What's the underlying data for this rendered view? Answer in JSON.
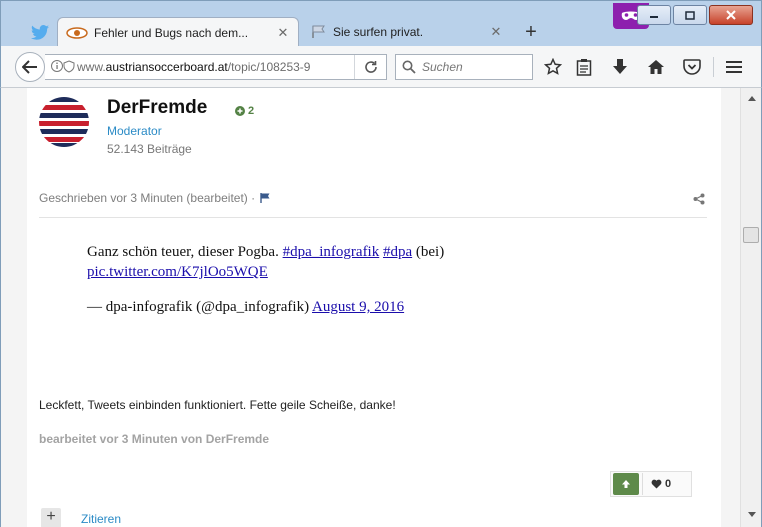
{
  "browser": {
    "tabs": [
      {
        "label": "Fehler und Bugs nach dem..."
      },
      {
        "label": "Sie surfen privat."
      }
    ],
    "url_prefix": "www.",
    "url_domain": "austriansoccerboard.at",
    "url_path": "/topic/108253-9",
    "search_placeholder": "Suchen"
  },
  "post": {
    "author": "DerFremde",
    "reputation": "2",
    "role": "Moderator",
    "post_count": "52.143 Beiträge",
    "meta": "Geschrieben vor 3 Minuten (bearbeitet) ·",
    "tweet": {
      "text": "Ganz schön teuer, dieser Pogba.",
      "hashtag1": "#dpa_infografik",
      "hashtag2": "#dpa",
      "suffix": "(bei)",
      "pic_link": "pic.twitter.com/K7jlOo5WQE",
      "signature": "— dpa-infografik (@dpa_infografik)",
      "date": "August 9, 2016"
    },
    "comment": "Leckfett, Tweets einbinden funktioniert. Fette geile Scheiße, danke!",
    "edited": "bearbeitet vor 3 Minuten von DerFremde",
    "likes": "0",
    "cutoff_action": "Zitieren"
  },
  "colors": {
    "moderator": "#2b8bc6",
    "upvote": "#5e8a4a",
    "private_badge": "#8d20ae"
  }
}
